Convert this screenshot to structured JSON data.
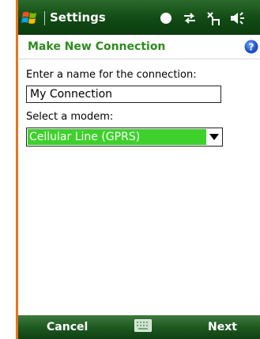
{
  "titlebar": {
    "title": "Settings",
    "icons": [
      "windows-start-icon",
      "status-circle-icon",
      "connectivity-arrows-icon",
      "signal-icon",
      "volume-icon"
    ]
  },
  "header": {
    "title": "Make New Connection",
    "help_icon": "help-icon"
  },
  "form": {
    "name_label": "Enter a name for the connection:",
    "name_value": "My Connection",
    "modem_label": "Select a modem:",
    "modem_value": "Cellular Line (GPRS)"
  },
  "softkeys": {
    "left": "Cancel",
    "right": "Next",
    "center_icon": "keyboard-icon"
  },
  "colors": {
    "accent_green": "#2e8b1f",
    "selection_green": "#3ed12c",
    "frame_orange": "#e8731e",
    "bar_green": "#114a14"
  }
}
